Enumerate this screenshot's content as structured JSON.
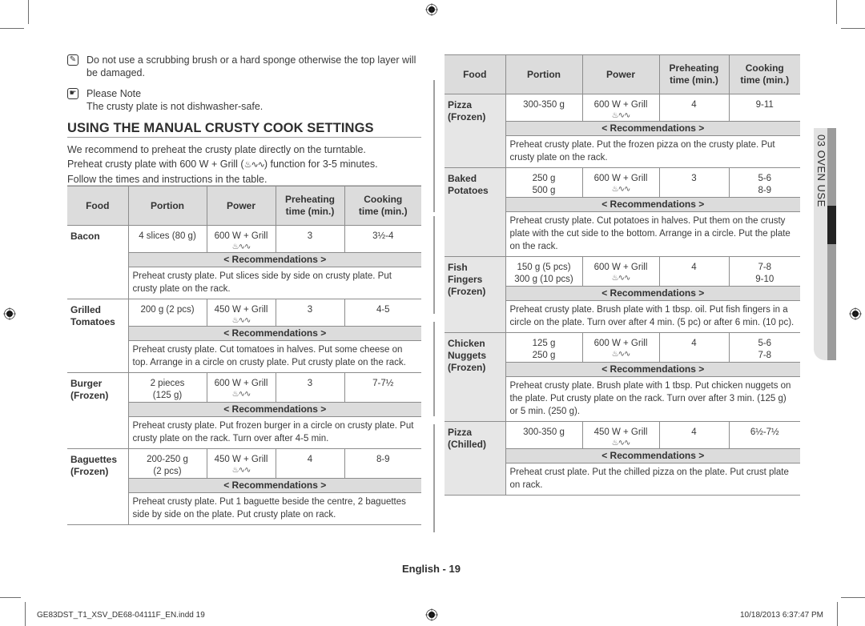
{
  "notes": {
    "warning_text": "Do not use a scrubbing brush or a hard sponge otherwise the top layer will be damaged.",
    "please_note_title": "Please Note",
    "please_note_text": "The crusty plate is not dishwasher-safe."
  },
  "section": {
    "heading": "USING THE MANUAL CRUSTY COOK SETTINGS",
    "intro_line1": "We recommend to preheat the crusty plate directly on the turntable.",
    "intro_line2_a": "Preheat crusty plate with 600 W + Grill (",
    "intro_line2_b": ") function for 3-5 minutes.",
    "intro_line3": "Follow the times and instructions in the table."
  },
  "table_headers": {
    "food": "Food",
    "portion": "Portion",
    "power": "Power",
    "preheat_1": "Preheating",
    "preheat_2": "time (min.)",
    "cooking_1": "Cooking",
    "cooking_2": "time (min.)"
  },
  "grill_icon": "♨∿∿",
  "rec_label": "< Recommendations >",
  "left_table": [
    {
      "food_1": "Bacon",
      "food_2": "",
      "food_3": "",
      "portion_1": "4 slices (80 g)",
      "portion_2": "",
      "power": "600 W + Grill",
      "preheat": "3",
      "cook_1": "3½-4",
      "cook_2": "",
      "rec": "Preheat crusty plate. Put slices side by side on crusty plate. Put crusty plate on the rack."
    },
    {
      "food_1": "Grilled",
      "food_2": "Tomatoes",
      "food_3": "",
      "portion_1": "200 g (2 pcs)",
      "portion_2": "",
      "power": "450 W + Grill",
      "preheat": "3",
      "cook_1": "4-5",
      "cook_2": "",
      "rec": "Preheat crusty plate. Cut tomatoes in halves. Put some cheese on top. Arrange in a circle on crusty plate. Put crusty plate on the rack."
    },
    {
      "food_1": "Burger",
      "food_2": "(Frozen)",
      "food_3": "",
      "portion_1": "2 pieces",
      "portion_2": "(125 g)",
      "power": "600 W + Grill",
      "preheat": "3",
      "cook_1": "7-7½",
      "cook_2": "",
      "rec": "Preheat crusty plate. Put frozen burger in a circle on crusty plate. Put crusty plate on the rack. Turn over after 4-5 min."
    },
    {
      "food_1": "Baguettes",
      "food_2": "(Frozen)",
      "food_3": "",
      "portion_1": "200-250 g",
      "portion_2": "(2 pcs)",
      "power": "450 W + Grill",
      "preheat": "4",
      "cook_1": "8-9",
      "cook_2": "",
      "rec": "Preheat crusty plate. Put 1 baguette beside the centre, 2 baguettes side by side on the plate. Put crusty plate on rack."
    }
  ],
  "right_table": [
    {
      "food_1": "Pizza",
      "food_2": "(Frozen)",
      "food_3": "",
      "portion_1": "300-350 g",
      "portion_2": "",
      "power": "600 W + Grill",
      "preheat": "4",
      "cook_1": "9-11",
      "cook_2": "",
      "rec": "Preheat crusty plate. Put the frozen pizza on the crusty plate. Put crusty plate on the rack."
    },
    {
      "food_1": "Baked",
      "food_2": "Potatoes",
      "food_3": "",
      "portion_1": "250 g",
      "portion_2": "500 g",
      "power": "600 W + Grill",
      "preheat": "3",
      "cook_1": "5-6",
      "cook_2": "8-9",
      "rec": "Preheat crusty plate. Cut potatoes in halves. Put them on the crusty plate with the cut side to the bottom. Arrange in a circle. Put the plate on the rack."
    },
    {
      "food_1": "Fish",
      "food_2": "Fingers",
      "food_3": "(Frozen)",
      "portion_1": "150 g (5 pcs)",
      "portion_2": "300 g (10 pcs)",
      "power": "600 W + Grill",
      "preheat": "4",
      "cook_1": "7-8",
      "cook_2": "9-10",
      "rec": "Preheat crusty plate. Brush plate with 1 tbsp. oil. Put fish fingers in a circle on the plate. Turn over after 4 min. (5 pc) or after 6 min. (10 pc)."
    },
    {
      "food_1": "Chicken",
      "food_2": "Nuggets",
      "food_3": "(Frozen)",
      "portion_1": "125 g",
      "portion_2": "250 g",
      "power": "600 W + Grill",
      "preheat": "4",
      "cook_1": "5-6",
      "cook_2": "7-8",
      "rec": "Preheat crusty plate. Brush plate with 1 tbsp. Put chicken nuggets on the plate. Put crusty plate on the rack. Turn over after 3 min. (125 g) or 5 min. (250 g)."
    },
    {
      "food_1": "Pizza",
      "food_2": "(Chilled)",
      "food_3": "",
      "portion_1": "300-350 g",
      "portion_2": "",
      "power": "450 W + Grill",
      "preheat": "4",
      "cook_1": "6½-7½",
      "cook_2": "",
      "rec": "Preheat crust plate. Put the chilled pizza on the plate. Put crust plate on rack."
    }
  ],
  "side_tab": {
    "label": "03  OVEN USE"
  },
  "footer": {
    "page_label": "English - 19",
    "file_name": "GE83DST_T1_XSV_DE68-04111F_EN.indd   19",
    "timestamp": "10/18/2013   6:37:47 PM"
  }
}
